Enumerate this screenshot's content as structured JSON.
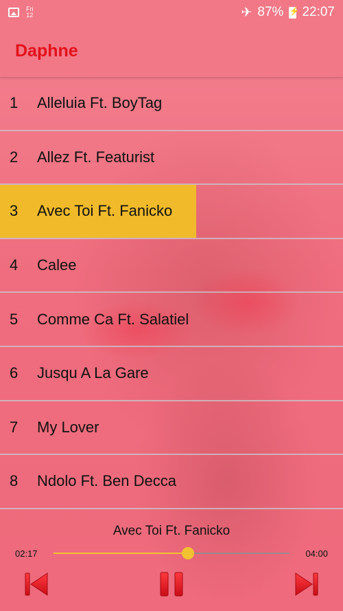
{
  "status_bar": {
    "day": "Fri",
    "date": "12",
    "battery": "87%",
    "time": "22:07",
    "icons": [
      "gallery-icon",
      "airplane-icon",
      "battery-charging-icon"
    ]
  },
  "app": {
    "title": "Daphne"
  },
  "tracks": [
    {
      "number": "1",
      "title": "Alleluia Ft. BoyTag"
    },
    {
      "number": "2",
      "title": "Allez Ft. Featurist"
    },
    {
      "number": "3",
      "title": "Avec Toi Ft. Fanicko"
    },
    {
      "number": "4",
      "title": "Calee"
    },
    {
      "number": "5",
      "title": "Comme Ca Ft. Salatiel"
    },
    {
      "number": "6",
      "title": "Jusqu A La Gare"
    },
    {
      "number": "7",
      "title": "My Lover"
    },
    {
      "number": "8",
      "title": "Ndolo Ft. Ben Decca"
    }
  ],
  "active_track": 3,
  "player": {
    "now_playing": "Avec Toi Ft. Fanicko",
    "current_time": "02:17",
    "total_time": "04:00",
    "progress": 0.57
  },
  "colors": {
    "title": "#e4111b",
    "highlight": "#f0ba2a",
    "controls": "#e3151c",
    "seek": "#f2c230"
  }
}
